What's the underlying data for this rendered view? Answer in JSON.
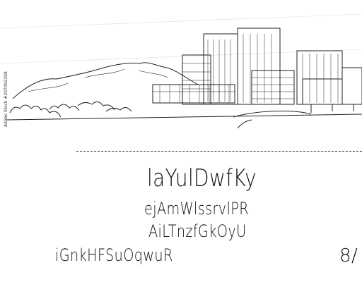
{
  "illustration": {
    "subject": "city-skyline-sketch",
    "side_credit": "Adobe Stock #207082208"
  },
  "text_lines": {
    "line1": "laYulDwfKy",
    "line2": "ejAmWlssrvlPR",
    "line3": "AiLTnzfGkOyU",
    "line4": "iGnkHFSuOqwuR",
    "line5": "8/"
  },
  "colors": {
    "ink": "#111111",
    "background": "#ffffff",
    "sketch": "#222222"
  }
}
